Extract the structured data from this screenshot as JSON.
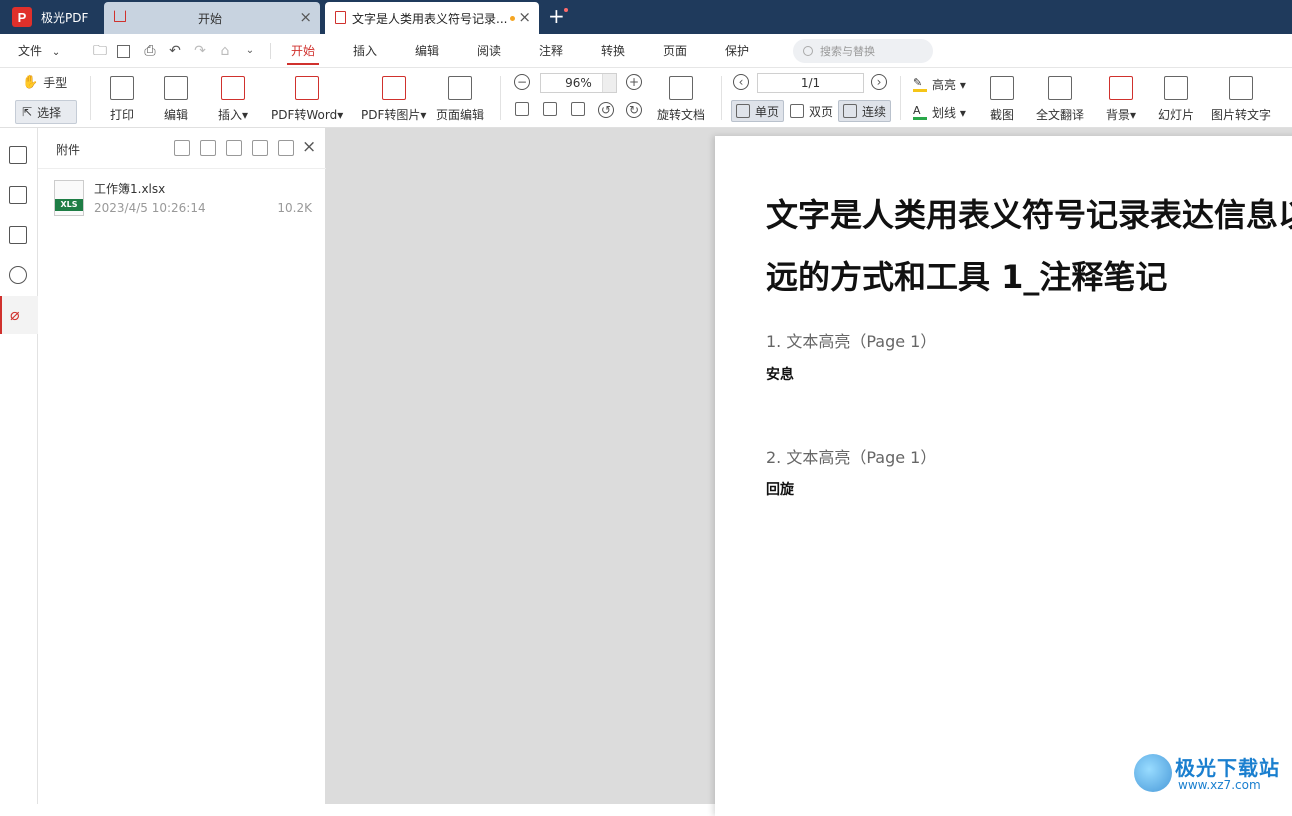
{
  "titlebar": {
    "app_name": "极光PDF",
    "app_logo": "P",
    "tabs": [
      {
        "label": "开始",
        "icon": "home-icon"
      },
      {
        "label": "文字是人类用表义符号记录...",
        "icon": "pdf-doc-icon"
      }
    ],
    "close_glyph": "×",
    "new_tab_glyph": "+"
  },
  "menubar": {
    "file": "文件",
    "items": [
      "开始",
      "插入",
      "编辑",
      "阅读",
      "注释",
      "转换",
      "页面",
      "保护"
    ],
    "active": "开始",
    "search_placeholder": "搜索与替换"
  },
  "ribbon": {
    "hand": "手型",
    "select": "选择",
    "print": "打印",
    "edit": "编辑",
    "insert": "插入▾",
    "pdf_to_word": "PDF转Word▾",
    "pdf_to_image": "PDF转图片▾",
    "page_edit": "页面编辑",
    "zoom": "96%",
    "rotate_doc": "旋转文档",
    "page_indicator": "1/1",
    "single": "单页",
    "double": "双页",
    "continuous": "连续",
    "highlight": "高亮 ▾",
    "strikeline": "划线 ▾",
    "screenshot": "截图",
    "translate": "全文翻译",
    "background": "背景▾",
    "slideshow": "幻灯片",
    "img_to_text": "图片转文字"
  },
  "attachment_panel": {
    "title": "附件",
    "files": [
      {
        "name": "工作簿1.xlsx",
        "date": "2023/4/5 10:26:14",
        "size": "10.2K",
        "type_tag": "XLS"
      }
    ]
  },
  "document": {
    "title_line1": "文字是人类用表义符号记录表达信息以",
    "title_line2": "远的方式和工具 1_注释笔记",
    "notes": [
      {
        "heading": "1. 文本高亮（Page 1）",
        "text": "安息"
      },
      {
        "heading": "2. 文本高亮（Page 1）",
        "text": "回旋"
      }
    ]
  },
  "watermark": {
    "line1": "极光下载站",
    "line2": "www.xz7.com"
  },
  "colors": {
    "titlebar": "#1f3a5c",
    "accent": "#d0312d",
    "canvas": "#dcdcdc"
  }
}
